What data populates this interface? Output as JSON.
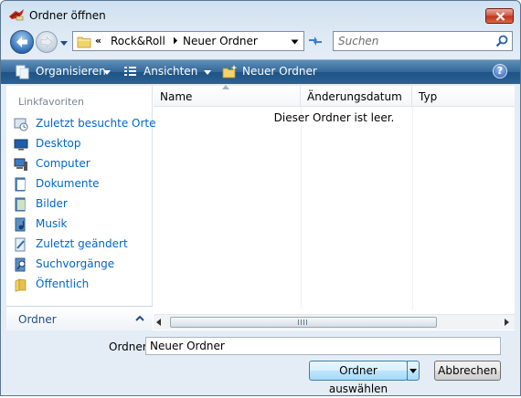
{
  "window": {
    "title": "Ordner öffnen"
  },
  "address": {
    "overflow": "«",
    "crumbs": [
      "Rock&Roll",
      "Neuer Ordner"
    ]
  },
  "search": {
    "placeholder": "Suchen"
  },
  "toolbar": {
    "organize": "Organisieren",
    "views": "Ansichten",
    "new_folder": "Neuer Ordner",
    "help": "?"
  },
  "sidebar": {
    "heading": "Linkfavoriten",
    "items": [
      {
        "label": "Zuletzt besuchte Orte",
        "icon": "recent-places-icon"
      },
      {
        "label": "Desktop",
        "icon": "desktop-icon"
      },
      {
        "label": "Computer",
        "icon": "computer-icon"
      },
      {
        "label": "Dokumente",
        "icon": "documents-icon"
      },
      {
        "label": "Bilder",
        "icon": "pictures-icon"
      },
      {
        "label": "Musik",
        "icon": "music-icon"
      },
      {
        "label": "Zuletzt geändert",
        "icon": "recently-changed-icon"
      },
      {
        "label": "Suchvorgänge",
        "icon": "searches-icon"
      },
      {
        "label": "Öffentlich",
        "icon": "public-folder-icon"
      }
    ],
    "folders_label": "Ordner"
  },
  "list": {
    "columns": [
      "Name",
      "Änderungsdatum",
      "Typ"
    ],
    "empty_message": "Dieser Ordner ist leer."
  },
  "footer": {
    "folder_label": "Ordner:",
    "folder_value": "Neuer Ordner",
    "select_button": "Ordner auswählen",
    "cancel_button": "Abbrechen"
  },
  "colors": {
    "link": "#0066cc",
    "toolbar": "#2a6394",
    "close": "#c1301a"
  }
}
